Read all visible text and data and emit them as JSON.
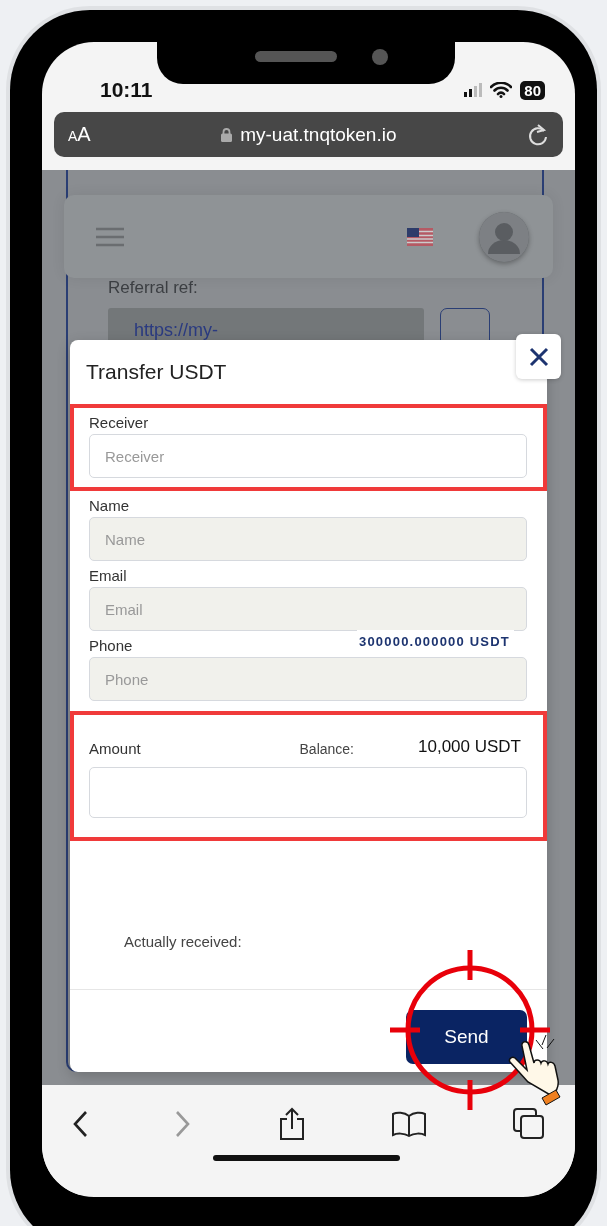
{
  "status_bar": {
    "time": "10:11",
    "battery": "80"
  },
  "url_bar": {
    "text_size_label": "AA",
    "url": "my-uat.tnqtoken.io"
  },
  "background_page": {
    "referral_label": "Referral ref:",
    "referral_link": "https://my-"
  },
  "modal": {
    "title": "Transfer USDT",
    "fields": [
      {
        "label": "Receiver",
        "placeholder": "Receiver",
        "disabled": false,
        "highlighted": true
      },
      {
        "label": "Name",
        "placeholder": "Name",
        "disabled": true,
        "highlighted": false
      },
      {
        "label": "Email",
        "placeholder": "Email",
        "disabled": true,
        "highlighted": false
      },
      {
        "label": "Phone",
        "placeholder": "Phone",
        "disabled": true,
        "highlighted": false
      }
    ],
    "amount": {
      "label": "Amount",
      "balance_label": "Balance:",
      "balance": "10,000 USDT",
      "highlighted": true
    },
    "actually_received_label": "Actually received:",
    "send_button": "Send"
  },
  "overlay_label": "300000.000000 USDT",
  "toolbar": {
    "back_disabled": false,
    "forward_disabled": true
  }
}
